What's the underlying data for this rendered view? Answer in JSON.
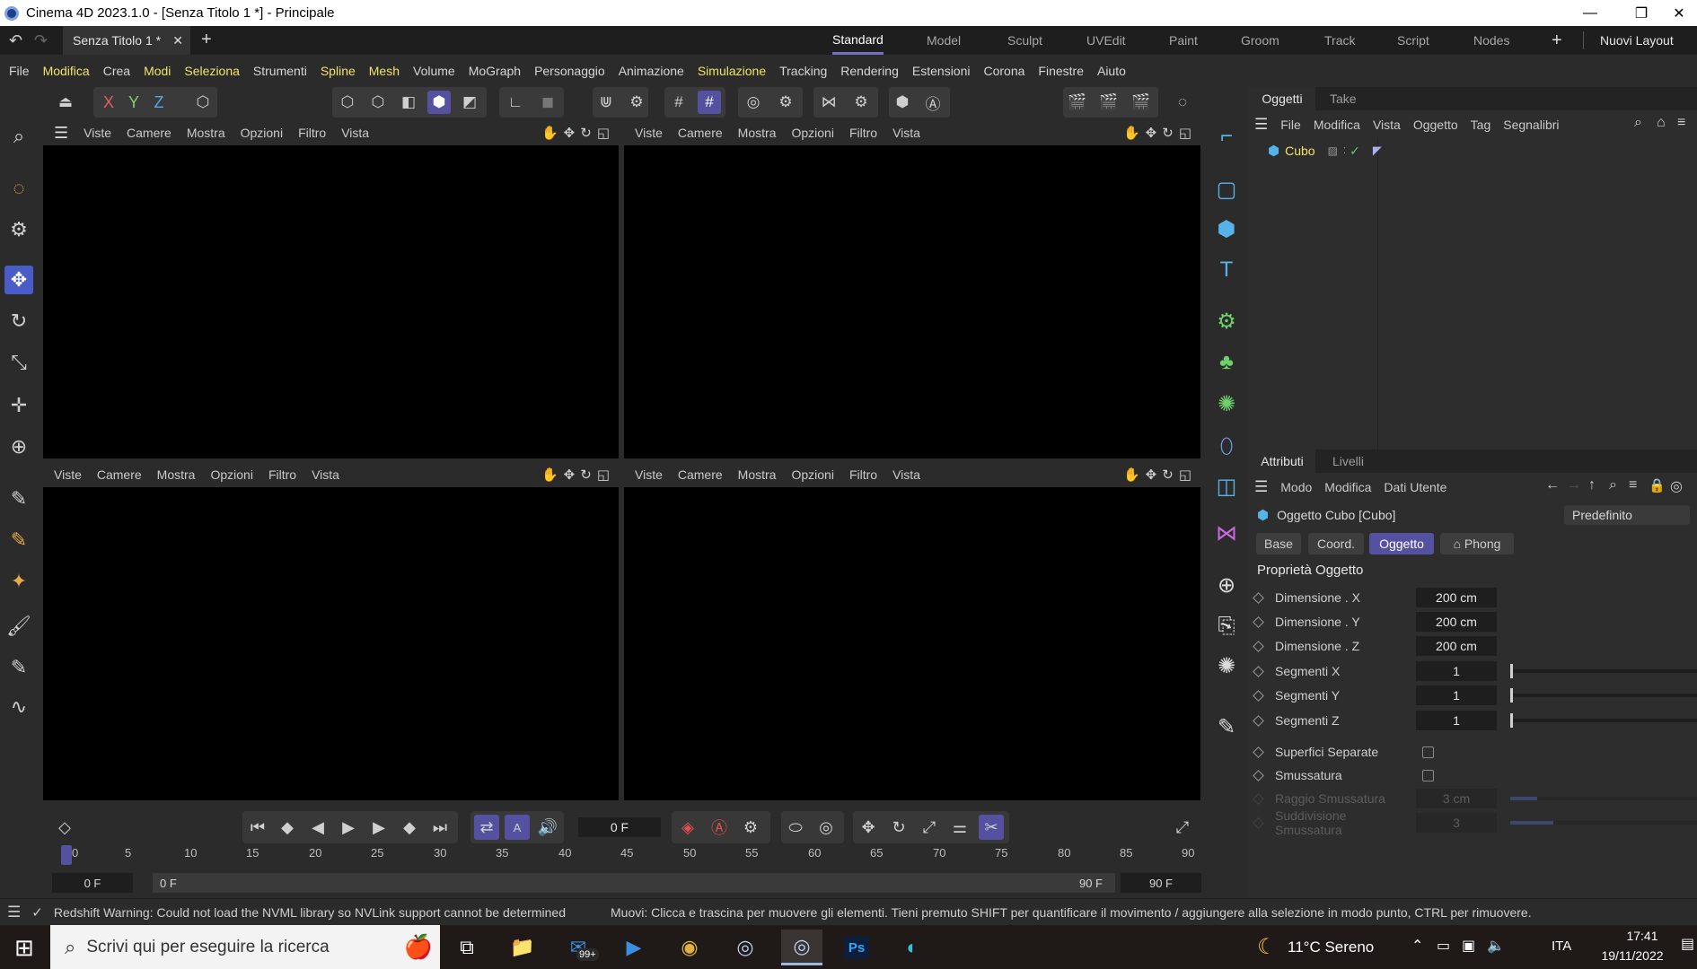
{
  "window": {
    "title": "Cinema 4D 2023.1.0 - [Senza Titolo 1 *] - Principale",
    "minimize": "—",
    "restore": "❐",
    "close": "✕"
  },
  "tabs": {
    "document": "Senza Titolo 1 *",
    "layouts": [
      "Standard",
      "Model",
      "Sculpt",
      "UVEdit",
      "Paint",
      "Groom",
      "Track",
      "Script",
      "Nodes"
    ],
    "active_layout": "Standard",
    "add": "+",
    "new_layouts": "Nuovi Layout"
  },
  "menu": {
    "items": [
      "File",
      "Modifica",
      "Crea",
      "Modi",
      "Seleziona",
      "Strumenti",
      "Spline",
      "Mesh",
      "Volume",
      "MoGraph",
      "Personaggio",
      "Animazione",
      "Simulazione",
      "Tracking",
      "Rendering",
      "Estensioni",
      "Corona",
      "Finestre",
      "Aiuto"
    ]
  },
  "axis": {
    "x": "X",
    "y": "Y",
    "z": "Z"
  },
  "viewport_menu": [
    "Viste",
    "Camere",
    "Mostra",
    "Opzioni",
    "Filtro",
    "Vista"
  ],
  "objects_panel": {
    "tabs": [
      "Oggetti",
      "Take"
    ],
    "menu": [
      "File",
      "Modifica",
      "Vista",
      "Oggetto",
      "Tag",
      "Segnalibri"
    ],
    "objects": [
      {
        "name": "Cubo"
      }
    ]
  },
  "attributes_panel": {
    "tabs": [
      "Attributi",
      "Livelli"
    ],
    "menu": [
      "Modo",
      "Modifica",
      "Dati Utente"
    ],
    "object_title": "Oggetto Cubo [Cubo]",
    "preset": "Predefinito",
    "subtabs": [
      "Base",
      "Coord.",
      "Oggetto",
      "⌂ Phong"
    ],
    "active_subtab": "Oggetto",
    "section_title": "Proprietà Oggetto",
    "properties": [
      {
        "label": "Dimensione . X",
        "value": "200 cm"
      },
      {
        "label": "Dimensione . Y",
        "value": "200 cm"
      },
      {
        "label": "Dimensione . Z",
        "value": "200 cm"
      },
      {
        "label": "Segmenti X",
        "value": "1"
      },
      {
        "label": "Segmenti Y",
        "value": "1"
      },
      {
        "label": "Segmenti Z",
        "value": "1"
      },
      {
        "label": "Superfici Separate",
        "checked": false
      },
      {
        "label": "Smussatura",
        "checked": false
      },
      {
        "label": "Raggio Smussatura",
        "value": "3 cm",
        "disabled": true
      },
      {
        "label": "Suddivisione Smussatura",
        "value": "3",
        "disabled": true
      }
    ]
  },
  "timeline": {
    "current_frame": "0 F",
    "ruler": [
      "0",
      "5",
      "10",
      "15",
      "20",
      "25",
      "30",
      "35",
      "40",
      "45",
      "50",
      "55",
      "60",
      "65",
      "70",
      "75",
      "80",
      "85",
      "90"
    ],
    "start": "0 F",
    "range_start": "0 F",
    "range_end": "90 F",
    "end": "90 F"
  },
  "status": {
    "warning": "Redshift Warning: Could not load the NVML library so NVLink support cannot be determined",
    "hint": "Muovi: Clicca e trascina per muovere gli elementi. Tieni premuto SHIFT per quantificare il movimento / aggiungere alla selezione in modo punto, CTRL per rimuovere."
  },
  "taskbar": {
    "search_placeholder": "Scrivi qui per eseguire la ricerca",
    "mail_badge": "99+",
    "weather": "11°C  Sereno",
    "language": "ITA",
    "time": "17:41",
    "date": "19/11/2022"
  },
  "colors": {
    "accent": "#5452a0",
    "highlight": "#f1e36a",
    "viewport": "#000000",
    "panel": "#2b2b2b"
  }
}
